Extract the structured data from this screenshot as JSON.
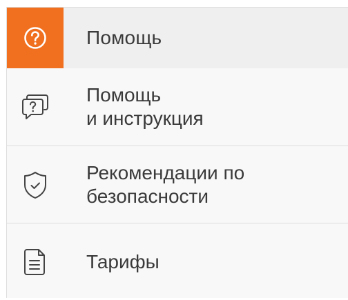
{
  "menu": {
    "header": {
      "label": "Помощь",
      "icon": "help-circle-icon",
      "accent_color": "#f07020"
    },
    "items": [
      {
        "icon": "help-chat-icon",
        "lines": [
          "Помощь",
          "и инструкция"
        ]
      },
      {
        "icon": "shield-check-icon",
        "lines": [
          "Рекомендации по",
          "безопасности"
        ]
      },
      {
        "icon": "document-icon",
        "lines": [
          "Тарифы"
        ]
      }
    ]
  }
}
